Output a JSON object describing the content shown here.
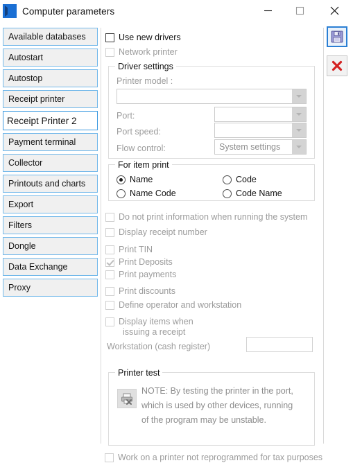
{
  "window": {
    "title": "Computer parameters",
    "logo_icon": "app-logo-chevron",
    "minimize_label": "—",
    "maximize_label": "□",
    "close_label": "✕"
  },
  "sidebar": {
    "items": [
      {
        "label": "Available databases",
        "selected": false
      },
      {
        "label": "Autostart",
        "selected": false
      },
      {
        "label": "Autostop",
        "selected": false
      },
      {
        "label": "Receipt printer",
        "selected": false
      },
      {
        "label": "Receipt Printer 2",
        "selected": true
      },
      {
        "label": "Payment terminal",
        "selected": false
      },
      {
        "label": "Collector",
        "selected": false
      },
      {
        "label": "Printouts and charts",
        "selected": false
      },
      {
        "label": "Export",
        "selected": false
      },
      {
        "label": "Filters",
        "selected": false
      },
      {
        "label": "Dongle",
        "selected": false
      },
      {
        "label": "Data Exchange",
        "selected": false
      },
      {
        "label": "Proxy",
        "selected": false
      }
    ]
  },
  "main": {
    "use_new_drivers": {
      "label": "Use new drivers",
      "checked": false,
      "enabled": true
    },
    "network_printer": {
      "label": "Network printer",
      "checked": false,
      "enabled": false
    },
    "driver_settings": {
      "title": "Driver settings",
      "printer_model_label": "Printer model :",
      "printer_model_value": "",
      "port_label": "Port:",
      "port_value": "",
      "port_speed_label": "Port speed:",
      "port_speed_value": "",
      "flow_control_label": "Flow control:",
      "flow_control_value": "System settings"
    },
    "for_item_print": {
      "title": "For item print",
      "options": [
        {
          "label": "Name",
          "selected": true
        },
        {
          "label": "Code",
          "selected": false
        },
        {
          "label": "Name Code",
          "selected": false
        },
        {
          "label": "Code Name",
          "selected": false
        }
      ]
    },
    "checkboxes": [
      {
        "label": "Do not print information when running the system",
        "checked": false,
        "enabled": false
      },
      {
        "label": "Display receipt number",
        "checked": false,
        "enabled": false
      },
      {
        "label": "Print TIN",
        "checked": false,
        "enabled": false
      },
      {
        "label": "Print Deposits",
        "checked": true,
        "enabled": false
      },
      {
        "label": "Print payments",
        "checked": false,
        "enabled": false
      },
      {
        "label": "Print discounts",
        "checked": false,
        "enabled": false
      },
      {
        "label": "Define operator and workstation",
        "checked": false,
        "enabled": false
      }
    ],
    "display_items": {
      "label_line1": "Display items when",
      "label_line2": "issuing a receipt",
      "checked": false,
      "enabled": false
    },
    "workstation": {
      "label": "Workstation (cash register)",
      "value": ""
    },
    "printer_test": {
      "title": "Printer test",
      "icon": "printer-test-icon",
      "note_line1": "NOTE: By testing the printer in the port,",
      "note_line2": "which is used by other devices, running",
      "note_line3": "of the program may be unstable."
    },
    "bottom_checkbox": {
      "label": "Work on a printer not reprogrammed for tax purposes",
      "checked": false,
      "enabled": false
    }
  },
  "toolbar": {
    "save_icon": "save-floppy-icon",
    "cancel_icon": "cancel-x-icon"
  },
  "colors": {
    "accent": "#2a7fd4",
    "sidebar_border": "#72b8ea",
    "cancel_red": "#d42020"
  }
}
